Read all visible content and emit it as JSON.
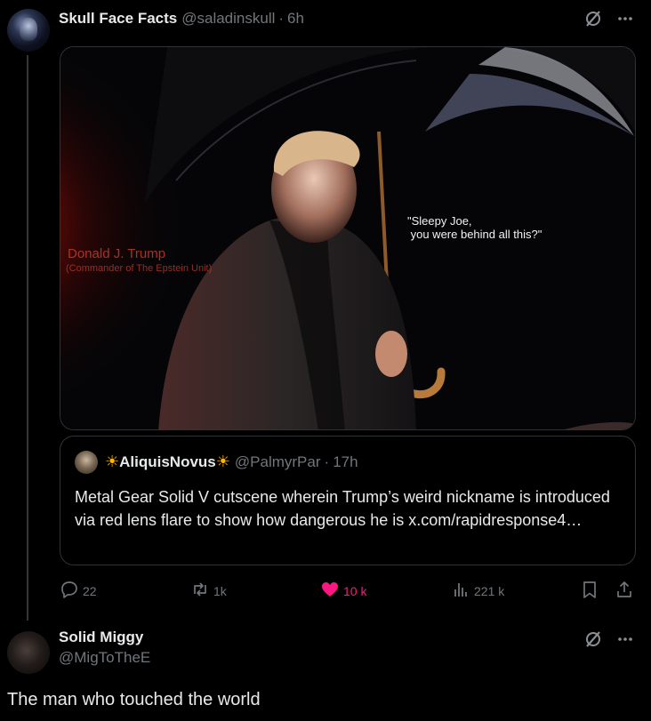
{
  "post": {
    "author_name": "Skull Face Facts",
    "author_handle": "@saladinskull",
    "separator": "·",
    "time": "6h",
    "media": {
      "caption_name": "Donald J. Trump",
      "caption_sub": "(Commander of The Epstein Unit)",
      "quote": "\"Sleepy Joe,\n you were behind all this?\""
    },
    "quoted": {
      "sun_left": "☀",
      "author_name": "AliquisNovus",
      "sun_right": "☀",
      "author_handle": "@PalmyrPar",
      "separator": "·",
      "time": "17h",
      "text": "Metal Gear Solid V cutscene wherein Trump’s weird nickname is introduced via red lens flare to show how dangerous he is x.com/rapidresponse4…"
    },
    "actions": {
      "replies": "22",
      "reposts": "1k",
      "likes": "10 k",
      "views": "221 k"
    }
  },
  "reply": {
    "author_name": "Solid Miggy",
    "author_handle": "@MigToTheE",
    "text": "The man who touched the world"
  },
  "icons": {
    "grok": "grok-icon",
    "more": "more-icon",
    "reply": "reply-icon",
    "repost": "repost-icon",
    "like": "heart-icon",
    "views": "views-icon",
    "bookmark": "bookmark-icon",
    "share": "share-icon"
  },
  "colors": {
    "background": "#000000",
    "text": "#e7e9ea",
    "muted": "#71767b",
    "like": "#f91880",
    "border": "#2f3336"
  }
}
